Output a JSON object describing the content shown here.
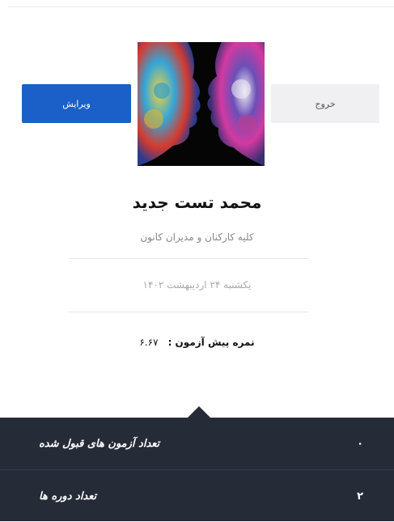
{
  "profile": {
    "name": "محمد تست جدید",
    "group": "کلیه کارکنان و مدیران کانون",
    "date": "یکشنبه ۲۴ اردیبهشت ۱۴۰۲"
  },
  "buttons": {
    "edit": "ویرایش",
    "exit": "خروج"
  },
  "score": {
    "label": "نمره پیش آزمون :",
    "value": "۶.۶۷"
  },
  "stats": [
    {
      "label": "تعداد آزمون های قبول شده",
      "value": "۰"
    },
    {
      "label": "تعداد دوره ها",
      "value": "۲"
    }
  ],
  "colors": {
    "accent": "#1b5fc8",
    "stats_background": "#262b38"
  }
}
